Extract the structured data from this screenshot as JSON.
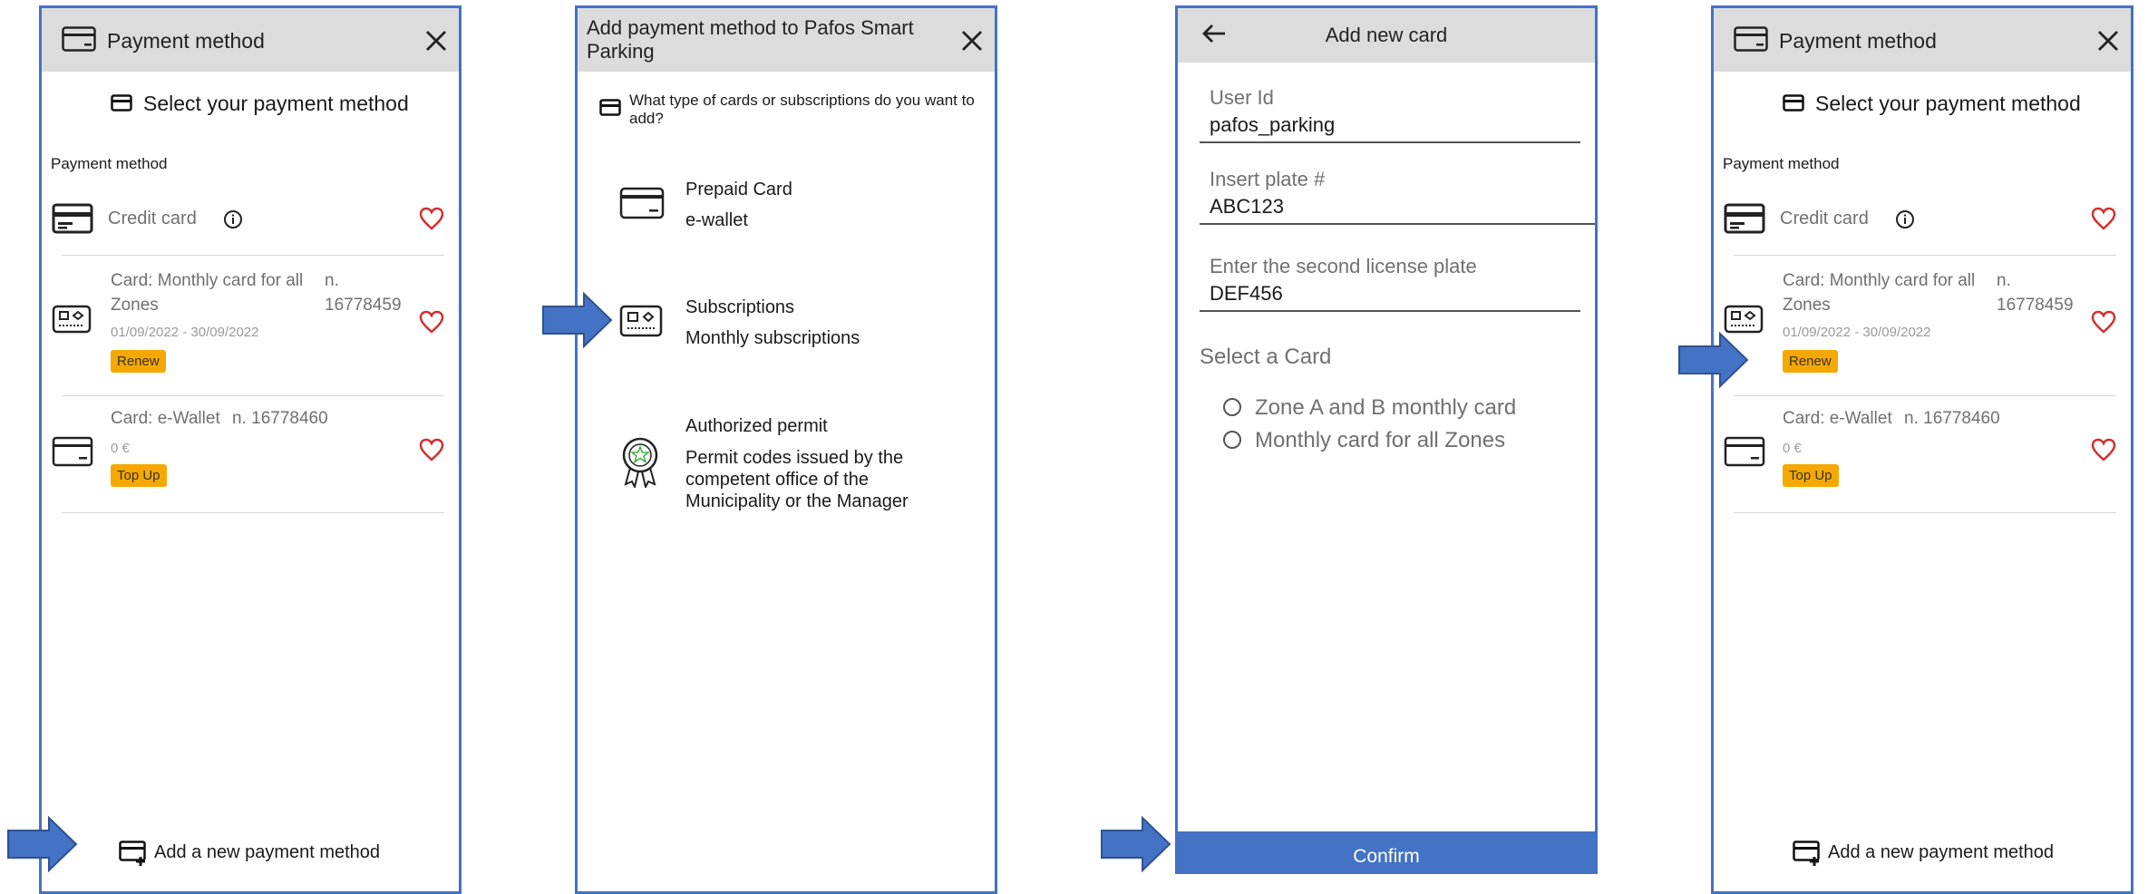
{
  "colors": {
    "accent": "#4472c4",
    "badge": "#f6a800",
    "header": "#dcdcdc",
    "heart": "#d32f2f"
  },
  "screen1": {
    "header_title": "Payment method",
    "subtitle": "Select your payment method",
    "section_label": "Payment method",
    "credit_card": "Credit card",
    "card1": {
      "title": "Card: Monthly card for all Zones",
      "number": "n. 16778459",
      "dates": "01/09/2022 - 30/09/2022",
      "badge": "Renew"
    },
    "card2": {
      "title": "Card: e-Wallet",
      "number": "n. 16778460",
      "balance": "0 €",
      "badge": "Top Up"
    },
    "add_button": "Add a new payment method"
  },
  "screen2": {
    "header_title": "Add payment method to Pafos Smart Parking",
    "question": "What type of cards or subscriptions do you want to add?",
    "options": [
      {
        "title": "Prepaid Card",
        "desc": "e-wallet",
        "icon": "card-icon"
      },
      {
        "title": "Subscriptions",
        "desc": "Monthly subscriptions",
        "icon": "subscription-card-icon"
      },
      {
        "title": "Authorized permit",
        "desc": "Permit codes issued by the competent office of the Municipality or the Manager",
        "icon": "permit-badge-icon"
      }
    ]
  },
  "screen3": {
    "header_title": "Add new card",
    "fields": [
      {
        "label": "User Id",
        "value": "pafos_parking"
      },
      {
        "label": "Insert plate #",
        "value": "ABC123"
      },
      {
        "label": "Enter the second license plate",
        "value": "DEF456"
      }
    ],
    "select_label": "Select a Card",
    "radio_options": [
      "Zone A and B monthly card",
      "Monthly card for all Zones"
    ],
    "confirm": "Confirm"
  },
  "screen4": {
    "header_title": "Payment method",
    "subtitle": "Select your payment method",
    "section_label": "Payment method",
    "credit_card": "Credit card",
    "card1": {
      "title": "Card: Monthly card for all Zones",
      "number": "n. 16778459",
      "dates": "01/09/2022 - 30/09/2022",
      "badge": "Renew"
    },
    "card2": {
      "title": "Card: e-Wallet",
      "number": "n. 16778460",
      "balance": "0 €",
      "badge": "Top Up"
    },
    "add_button": "Add a new payment method"
  }
}
